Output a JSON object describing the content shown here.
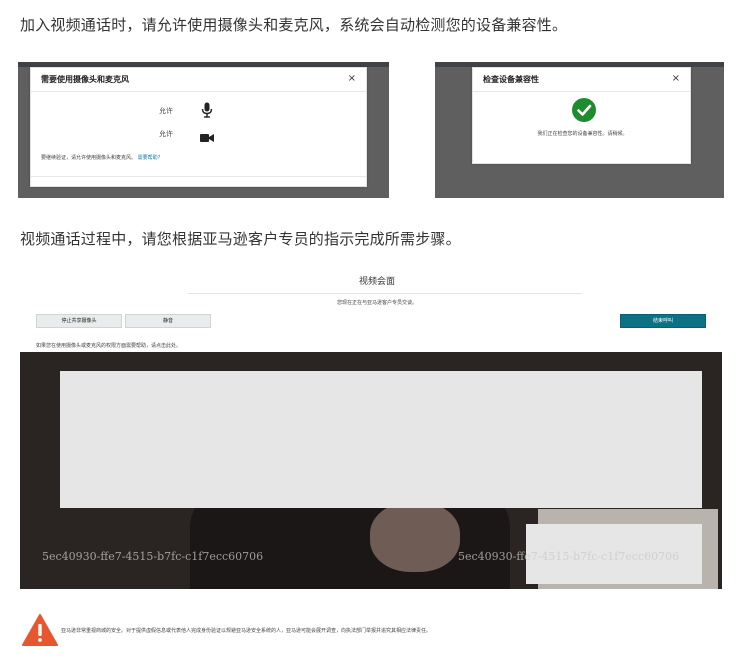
{
  "instructions": {
    "step1": "加入视频通话时，请允许使用摄像头和麦克风，系统会自动检测您的设备兼容性。",
    "step2": "视频通话过程中，请您根据亚马逊客户专员的指示完成所需步骤。"
  },
  "permission_dialog": {
    "title": "需要使用摄像头和麦克风",
    "close": "×",
    "mic_label": "允许",
    "camera_label": "允许",
    "note_prefix": "要继续验证，请允许使用摄像头和麦克风。",
    "help_link": "需要帮助?"
  },
  "compat_dialog": {
    "title": "检查设备兼容性",
    "close": "×",
    "status": "我们正在检查您的设备兼容性。请稍候。"
  },
  "meeting": {
    "title": "视频会面",
    "subtitle": "您现在正在与亚马逊客户专员交谈。",
    "stop_camera_button": "停止共享摄像头",
    "mute_button": "静音",
    "end_call_button": "结束呼叫",
    "help_text": "如果您在使用摄像头或麦克风的权限方面需要帮助，请点击此处。",
    "watermark_left": "5ec40930-ffe7-4515-b7fc-c1f7ecc60706",
    "watermark_right": "5ec40930-ffe7-4515-b7fc-c1f7ecc60706"
  },
  "footer": {
    "warning_text": "亚马逊非常重视商城的安全。对于提供虚假信息或代表他人完成身份验证以规避亚马逊安全系统的人，亚马逊可能会展开调查，向执法部门举报并追究其相应法律责任。"
  },
  "colors": {
    "accent_teal": "#0b7285",
    "success_green": "#1e8b2e",
    "warning_orange": "#e8562e"
  }
}
